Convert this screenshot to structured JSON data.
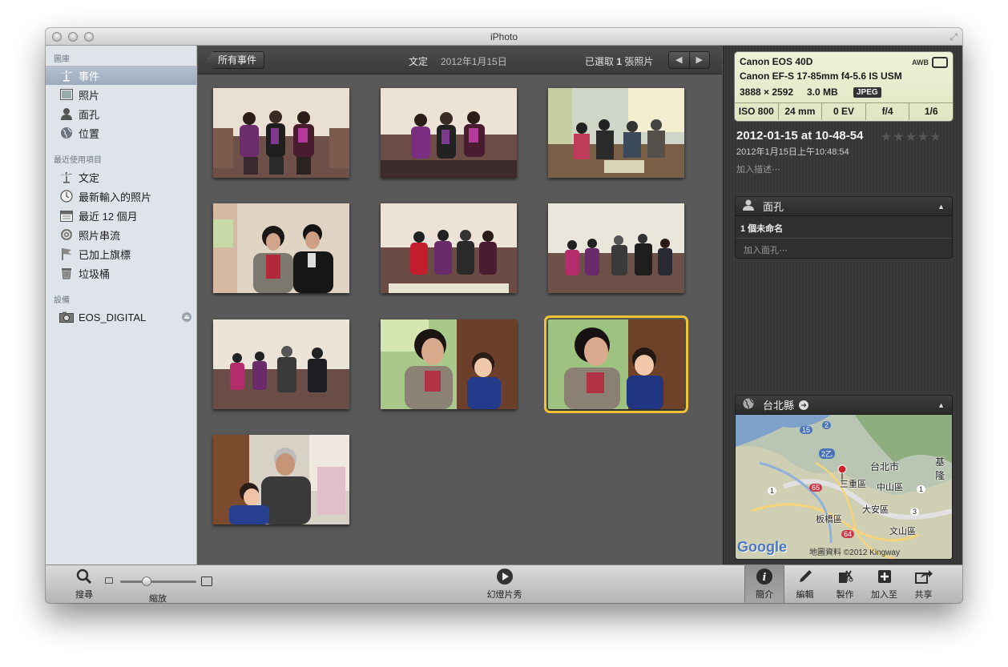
{
  "window": {
    "title": "iPhoto"
  },
  "sidebar": {
    "sections": [
      {
        "heading": "圖庫",
        "items": [
          {
            "label": "事件",
            "icon": "palm-tree-icon",
            "selected": true
          },
          {
            "label": "照片",
            "icon": "photo-icon"
          },
          {
            "label": "面孔",
            "icon": "person-icon"
          },
          {
            "label": "位置",
            "icon": "globe-icon"
          }
        ]
      },
      {
        "heading": "最近使用項目",
        "items": [
          {
            "label": "文定",
            "icon": "palm-tree-icon"
          },
          {
            "label": "最新輸入的照片",
            "icon": "clock-icon"
          },
          {
            "label": "最近 12 個月",
            "icon": "calendar-icon"
          },
          {
            "label": "照片串流",
            "icon": "photostream-icon"
          },
          {
            "label": "已加上旗標",
            "icon": "flag-icon"
          },
          {
            "label": "垃圾桶",
            "icon": "trash-icon"
          }
        ]
      },
      {
        "heading": "設備",
        "items": [
          {
            "label": "EOS_DIGITAL",
            "icon": "camera-icon",
            "eject": true
          }
        ]
      }
    ]
  },
  "topbar": {
    "back_label": "所有事件",
    "event_name": "文定",
    "event_date": "2012年1月15日",
    "selection_prefix": "已選取 ",
    "selection_count": "1",
    "selection_suffix": " 張照片"
  },
  "photos": [
    {
      "scene": "sofa-four",
      "selected": false
    },
    {
      "scene": "sofa-four-b",
      "selected": false
    },
    {
      "scene": "living-room-group",
      "selected": false
    },
    {
      "scene": "couple-closeup",
      "selected": false
    },
    {
      "scene": "sofa-five",
      "selected": false
    },
    {
      "scene": "sofa-six",
      "selected": false
    },
    {
      "scene": "sofa-six-b",
      "selected": false
    },
    {
      "scene": "woman-child-peace",
      "selected": false
    },
    {
      "scene": "woman-child",
      "selected": true
    },
    {
      "scene": "man-child",
      "selected": false
    }
  ],
  "info": {
    "camera": "Canon EOS 40D",
    "lens": "Canon EF-S 17-85mm f4-5.6 IS USM",
    "dimensions": "3888 × 2592",
    "filesize": "3.0 MB",
    "format": "JPEG",
    "wb": "AWB",
    "iso": "ISO 800",
    "focal": "24 mm",
    "ev": "0 EV",
    "aperture": "f/4",
    "shutter": "1/6",
    "photo_title": "2012-01-15 at 10-48-54",
    "datetime": "2012年1月15日上午10:48:54",
    "add_description": "加入描述⋯",
    "rating_stars": "★★★★★",
    "faces": {
      "heading": "面孔",
      "unnamed": "1 個未命名",
      "add_face": "加入面孔⋯"
    },
    "place": {
      "heading": "台北縣",
      "labels": [
        "台北市",
        "基隆",
        "三重區",
        "中山區",
        "大安區",
        "板橋區",
        "文山區"
      ],
      "route_numbers": [
        "15",
        "2",
        "2乙",
        "1",
        "65",
        "1",
        "3",
        "64"
      ],
      "google": "Google",
      "copyright": "地圖資料 ©2012 Kingway"
    }
  },
  "toolbar": {
    "search": "搜尋",
    "zoom": "縮放",
    "zoom_level": 0.35,
    "slideshow": "幻燈片秀",
    "info": "簡介",
    "edit": "編輯",
    "create": "製作",
    "add_to": "加入至",
    "share": "共享"
  },
  "colors": {
    "selection": "#f1c232",
    "sidebar_bg": "#dfe4eb",
    "grid_bg": "#595959",
    "exif_bg": "#e7ecd0"
  }
}
